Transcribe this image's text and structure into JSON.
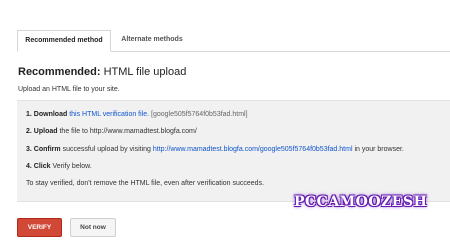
{
  "tabs": {
    "recommended": "Recommended method",
    "alternate": "Alternate methods"
  },
  "heading": {
    "bold": "Recommended:",
    "rest": " HTML file upload"
  },
  "intro": "Upload an HTML file to your site.",
  "steps": {
    "s1": {
      "num": "1.",
      "bold": "Download",
      "link": "this HTML verification file.",
      "file": "[google505f5764f0b53fad.html]"
    },
    "s2": {
      "num": "2.",
      "bold": "Upload",
      "text": "the file to http://www.mamadtest.blogfa.com/"
    },
    "s3": {
      "num": "3.",
      "bold": "Confirm",
      "text": "successful upload by visiting",
      "link": "http://www.mamadtest.blogfa.com/google505f5764f0b53fad.html",
      "tail": "in your browser."
    },
    "s4": {
      "num": "4.",
      "bold": "Click",
      "text": "Verify below."
    },
    "note": "To stay verified, don't remove the HTML file, even after verification succeeds."
  },
  "buttons": {
    "verify": "VERIFY",
    "not_now": "Not now"
  },
  "watermark": "PCCAMOOZESH",
  "colors": {
    "verify_button": "#d14836",
    "link": "#1155cc",
    "panel_bg": "#f1f1f1"
  }
}
